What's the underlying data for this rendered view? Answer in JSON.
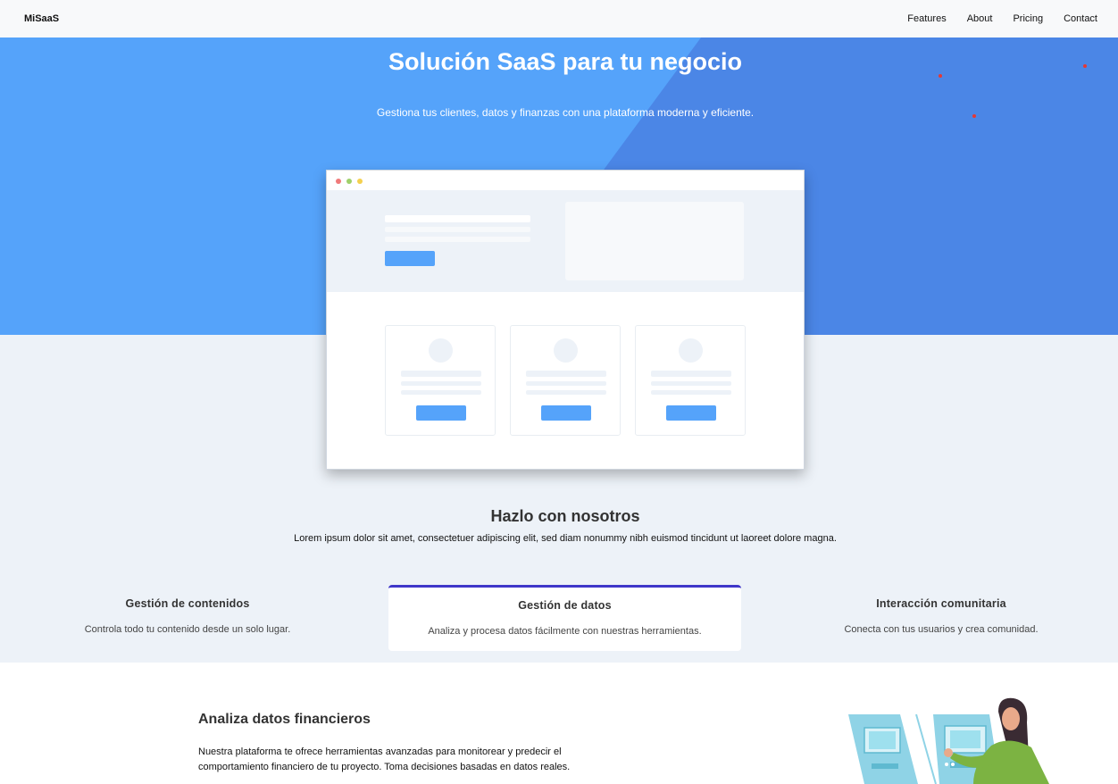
{
  "nav": {
    "brand": "MiSaaS",
    "links": [
      "Features",
      "About",
      "Pricing",
      "Contact"
    ]
  },
  "hero": {
    "title": "Solución SaaS para tu negocio",
    "subtitle": "Gestiona tus clientes, datos y finanzas con una plataforma moderna y eficiente."
  },
  "section": {
    "title": "Hazlo con nosotros",
    "subtitle": "Lorem ipsum dolor sit amet, consectetuer adipiscing elit, sed diam nonummy nibh euismod tincidunt ut laoreet dolore magna."
  },
  "features": [
    {
      "title": "Gestión de contenidos",
      "description": "Controla todo tu contenido desde un solo lugar."
    },
    {
      "title": "Gestión de datos",
      "description": "Analiza y procesa datos fácilmente con nuestras herramientas."
    },
    {
      "title": "Interacción comunitaria",
      "description": "Conecta con tus usuarios y crea comunidad."
    }
  ],
  "finance": {
    "title": "Analiza datos financieros",
    "text": "Nuestra plataforma te ofrece herramientas avanzadas para monitorear y predecir el comportamiento financiero de tu proyecto. Toma decisiones basadas en datos reales."
  },
  "colors": {
    "hero_light": "#55a3fa",
    "hero_dark": "#4b86e6",
    "accent": "#3f37c9",
    "section_bg": "#edf2f8"
  }
}
